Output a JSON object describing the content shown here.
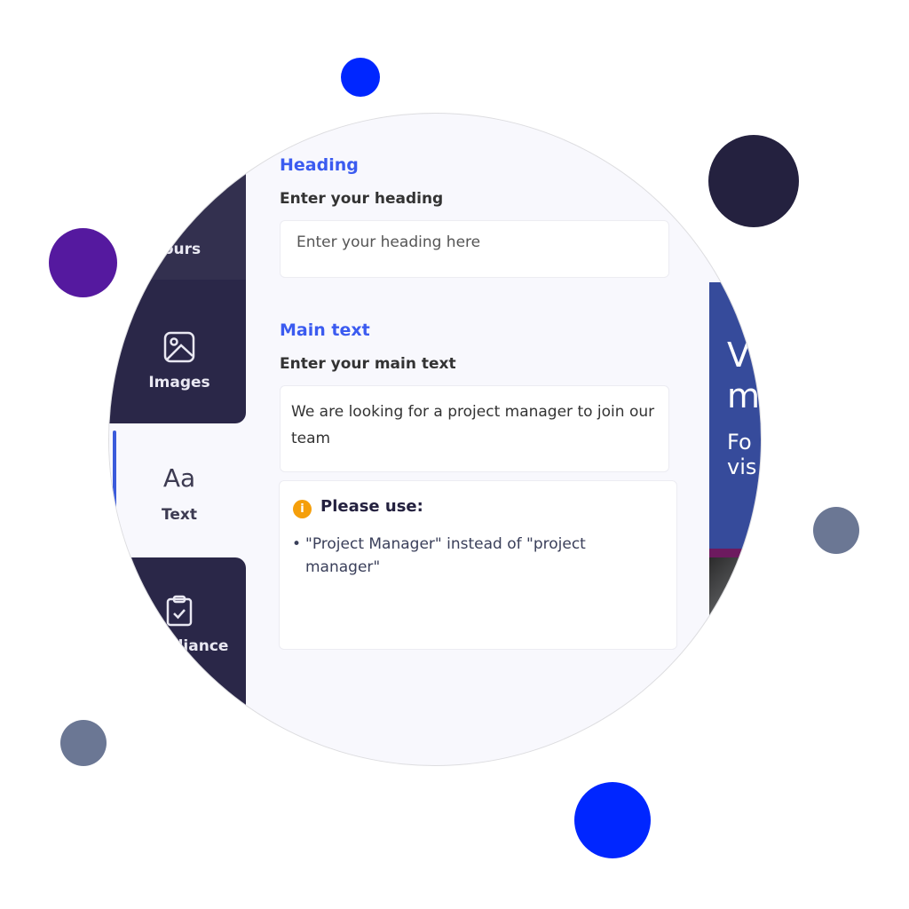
{
  "colors": {
    "brand_blue": "#0026ff",
    "navy": "#24213f",
    "purple": "#55199f",
    "slate": "#6b7794",
    "sidebar_dark": "#2a2748",
    "accent_blue": "#3b5bf0",
    "warning_orange": "#f59f0b",
    "preview_blue": "#364b9b"
  },
  "sidebar": {
    "items": [
      {
        "label": "Colours",
        "icon": "palette-icon",
        "active": false
      },
      {
        "label": "Images",
        "icon": "image-icon",
        "active": false
      },
      {
        "label": "Text",
        "icon": "text-aa-icon",
        "glyph": "Aa",
        "active": true
      },
      {
        "label": "Compliance",
        "icon": "clipboard-check-icon",
        "active": false
      }
    ]
  },
  "form": {
    "heading_section": {
      "title": "Heading",
      "label": "Enter your heading",
      "placeholder": "Enter your heading here",
      "value": ""
    },
    "main_text_section": {
      "title": "Main text",
      "label": "Enter your main text",
      "value": "We are looking for a project manager to join our team"
    },
    "notice": {
      "icon": "info-icon",
      "title": "Please use:",
      "items": [
        "\"Project Manager\" instead of \"project manager\""
      ]
    }
  },
  "preview": {
    "headline_fragment": "W m",
    "headline_line1": "V",
    "headline_line2": "m",
    "body_line1": "Fo",
    "body_line2": "vis"
  }
}
